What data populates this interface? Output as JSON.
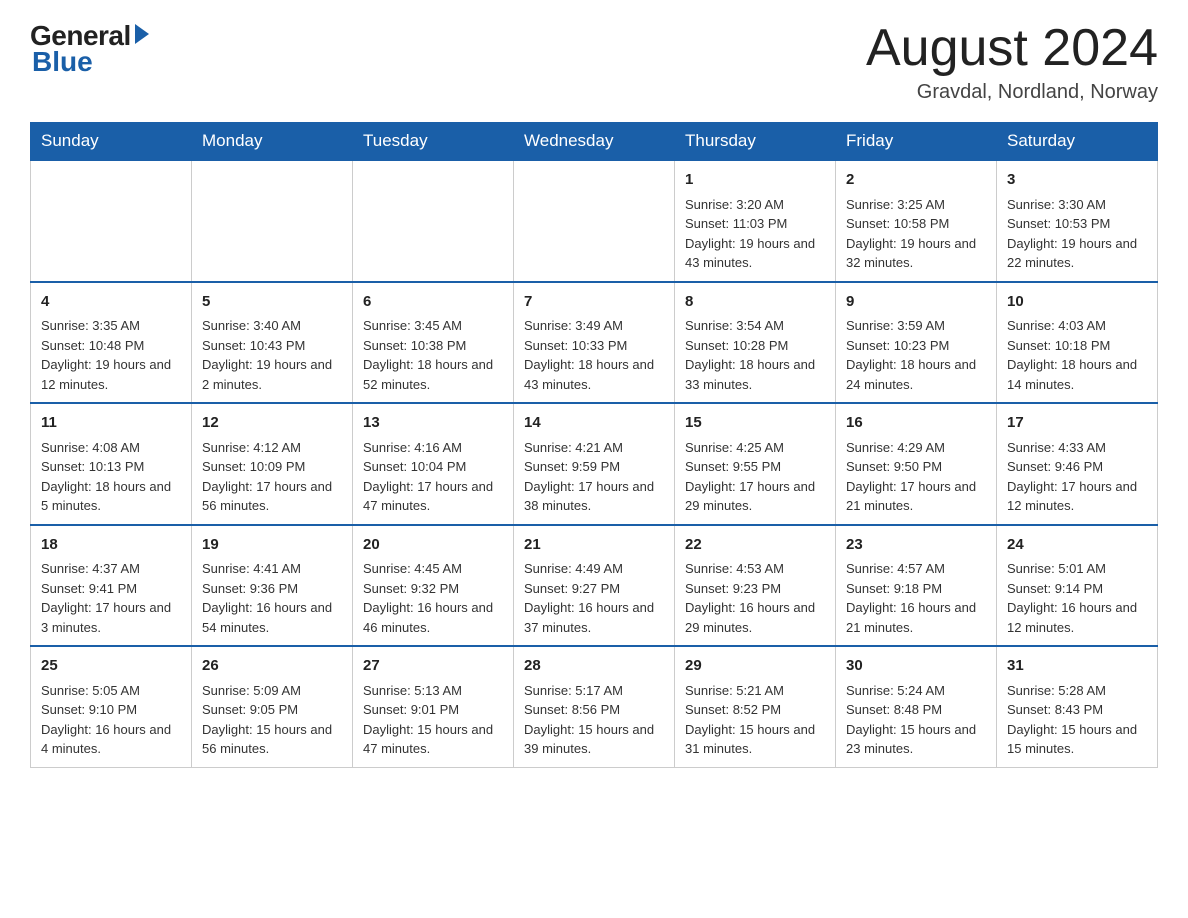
{
  "logo": {
    "general": "General",
    "blue": "Blue"
  },
  "title": "August 2024",
  "location": "Gravdal, Nordland, Norway",
  "weekdays": [
    "Sunday",
    "Monday",
    "Tuesday",
    "Wednesday",
    "Thursday",
    "Friday",
    "Saturday"
  ],
  "weeks": [
    [
      {
        "day": "",
        "content": ""
      },
      {
        "day": "",
        "content": ""
      },
      {
        "day": "",
        "content": ""
      },
      {
        "day": "",
        "content": ""
      },
      {
        "day": "1",
        "content": "Sunrise: 3:20 AM\nSunset: 11:03 PM\nDaylight: 19 hours and 43 minutes."
      },
      {
        "day": "2",
        "content": "Sunrise: 3:25 AM\nSunset: 10:58 PM\nDaylight: 19 hours and 32 minutes."
      },
      {
        "day": "3",
        "content": "Sunrise: 3:30 AM\nSunset: 10:53 PM\nDaylight: 19 hours and 22 minutes."
      }
    ],
    [
      {
        "day": "4",
        "content": "Sunrise: 3:35 AM\nSunset: 10:48 PM\nDaylight: 19 hours and 12 minutes."
      },
      {
        "day": "5",
        "content": "Sunrise: 3:40 AM\nSunset: 10:43 PM\nDaylight: 19 hours and 2 minutes."
      },
      {
        "day": "6",
        "content": "Sunrise: 3:45 AM\nSunset: 10:38 PM\nDaylight: 18 hours and 52 minutes."
      },
      {
        "day": "7",
        "content": "Sunrise: 3:49 AM\nSunset: 10:33 PM\nDaylight: 18 hours and 43 minutes."
      },
      {
        "day": "8",
        "content": "Sunrise: 3:54 AM\nSunset: 10:28 PM\nDaylight: 18 hours and 33 minutes."
      },
      {
        "day": "9",
        "content": "Sunrise: 3:59 AM\nSunset: 10:23 PM\nDaylight: 18 hours and 24 minutes."
      },
      {
        "day": "10",
        "content": "Sunrise: 4:03 AM\nSunset: 10:18 PM\nDaylight: 18 hours and 14 minutes."
      }
    ],
    [
      {
        "day": "11",
        "content": "Sunrise: 4:08 AM\nSunset: 10:13 PM\nDaylight: 18 hours and 5 minutes."
      },
      {
        "day": "12",
        "content": "Sunrise: 4:12 AM\nSunset: 10:09 PM\nDaylight: 17 hours and 56 minutes."
      },
      {
        "day": "13",
        "content": "Sunrise: 4:16 AM\nSunset: 10:04 PM\nDaylight: 17 hours and 47 minutes."
      },
      {
        "day": "14",
        "content": "Sunrise: 4:21 AM\nSunset: 9:59 PM\nDaylight: 17 hours and 38 minutes."
      },
      {
        "day": "15",
        "content": "Sunrise: 4:25 AM\nSunset: 9:55 PM\nDaylight: 17 hours and 29 minutes."
      },
      {
        "day": "16",
        "content": "Sunrise: 4:29 AM\nSunset: 9:50 PM\nDaylight: 17 hours and 21 minutes."
      },
      {
        "day": "17",
        "content": "Sunrise: 4:33 AM\nSunset: 9:46 PM\nDaylight: 17 hours and 12 minutes."
      }
    ],
    [
      {
        "day": "18",
        "content": "Sunrise: 4:37 AM\nSunset: 9:41 PM\nDaylight: 17 hours and 3 minutes."
      },
      {
        "day": "19",
        "content": "Sunrise: 4:41 AM\nSunset: 9:36 PM\nDaylight: 16 hours and 54 minutes."
      },
      {
        "day": "20",
        "content": "Sunrise: 4:45 AM\nSunset: 9:32 PM\nDaylight: 16 hours and 46 minutes."
      },
      {
        "day": "21",
        "content": "Sunrise: 4:49 AM\nSunset: 9:27 PM\nDaylight: 16 hours and 37 minutes."
      },
      {
        "day": "22",
        "content": "Sunrise: 4:53 AM\nSunset: 9:23 PM\nDaylight: 16 hours and 29 minutes."
      },
      {
        "day": "23",
        "content": "Sunrise: 4:57 AM\nSunset: 9:18 PM\nDaylight: 16 hours and 21 minutes."
      },
      {
        "day": "24",
        "content": "Sunrise: 5:01 AM\nSunset: 9:14 PM\nDaylight: 16 hours and 12 minutes."
      }
    ],
    [
      {
        "day": "25",
        "content": "Sunrise: 5:05 AM\nSunset: 9:10 PM\nDaylight: 16 hours and 4 minutes."
      },
      {
        "day": "26",
        "content": "Sunrise: 5:09 AM\nSunset: 9:05 PM\nDaylight: 15 hours and 56 minutes."
      },
      {
        "day": "27",
        "content": "Sunrise: 5:13 AM\nSunset: 9:01 PM\nDaylight: 15 hours and 47 minutes."
      },
      {
        "day": "28",
        "content": "Sunrise: 5:17 AM\nSunset: 8:56 PM\nDaylight: 15 hours and 39 minutes."
      },
      {
        "day": "29",
        "content": "Sunrise: 5:21 AM\nSunset: 8:52 PM\nDaylight: 15 hours and 31 minutes."
      },
      {
        "day": "30",
        "content": "Sunrise: 5:24 AM\nSunset: 8:48 PM\nDaylight: 15 hours and 23 minutes."
      },
      {
        "day": "31",
        "content": "Sunrise: 5:28 AM\nSunset: 8:43 PM\nDaylight: 15 hours and 15 minutes."
      }
    ]
  ]
}
